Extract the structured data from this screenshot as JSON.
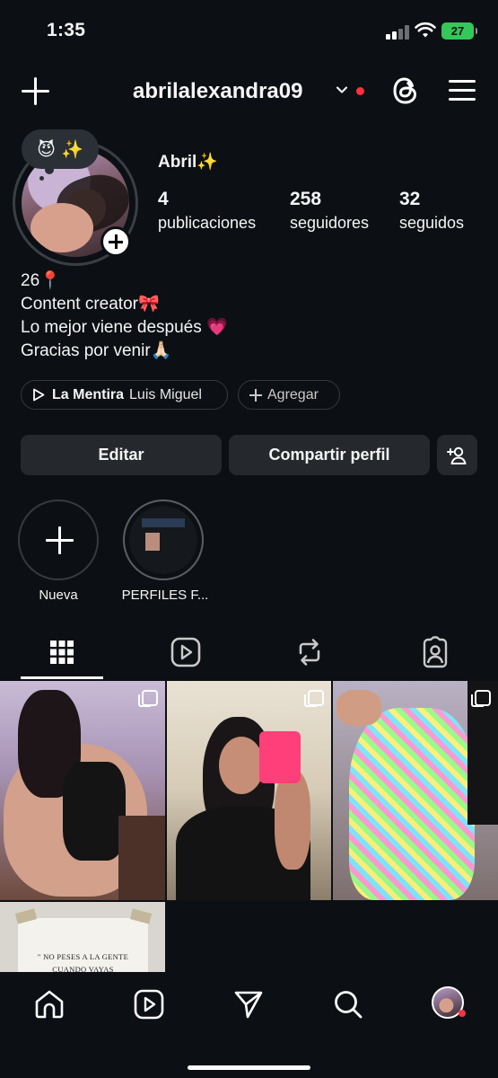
{
  "status_bar": {
    "time": "1:35",
    "battery": "27"
  },
  "header": {
    "username": "abrilalexandra09"
  },
  "profile": {
    "note": [
      "😈",
      "✨"
    ],
    "display_name": "Abril✨",
    "stats": [
      {
        "value": "4",
        "label": "publicaciones"
      },
      {
        "value": "258",
        "label": "seguidores"
      },
      {
        "value": "32",
        "label": "seguidos"
      }
    ],
    "bio": [
      "26📍",
      "Content creator🎀",
      "Lo mejor viene después 💗",
      "Gracias por venir🙏🏻"
    ],
    "music": {
      "song": "La Mentira",
      "artist": "Luis Miguel"
    },
    "add_label": "Agregar"
  },
  "actions": {
    "edit": "Editar",
    "share": "Compartir perfil"
  },
  "highlights": [
    {
      "label": "Nueva"
    },
    {
      "label": "PERFILES F..."
    }
  ],
  "grid": {
    "post4_text": [
      "\" NO PESES A LA GENTE",
      "CUANDO VAYAS"
    ]
  },
  "colors": {
    "background": "#0c1014",
    "button": "#25292e",
    "notification": "#ff3040",
    "battery": "#34c759"
  },
  "icons": {
    "header": [
      "plus-icon",
      "chevron-down-icon",
      "threads-icon",
      "menu-icon"
    ],
    "tabs": [
      "grid-icon",
      "reels-icon",
      "reposts-icon",
      "tagged-icon"
    ],
    "nav": [
      "home-icon",
      "reels-icon",
      "send-icon",
      "search-icon",
      "profile-avatar"
    ]
  }
}
